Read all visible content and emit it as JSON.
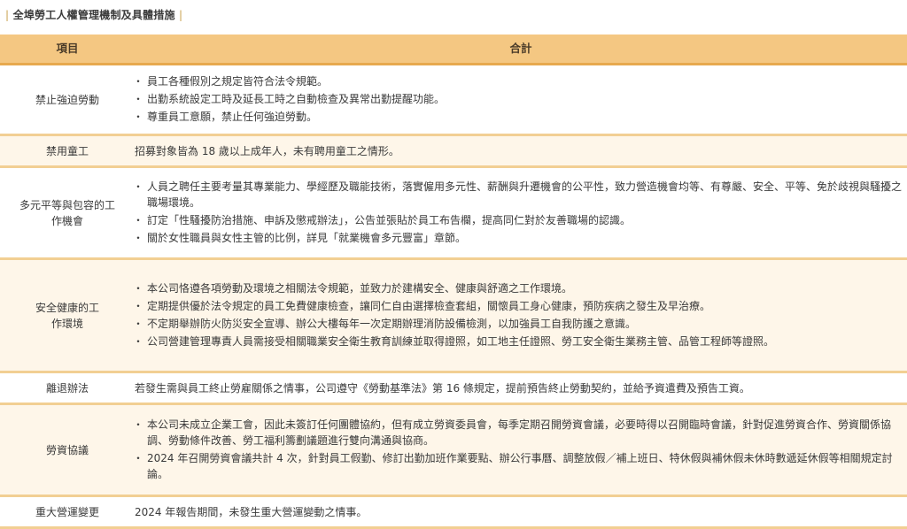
{
  "title": "全埠勞工人權管理機制及具體措施",
  "header": {
    "col1": "項目",
    "col2": "合計"
  },
  "rows": [
    {
      "label": "禁止強迫勞動",
      "items": [
        "員工各種假別之規定皆符合法令規範。",
        "出勤系統設定工時及延長工時之自動檢查及異常出勤提醒功能。",
        "尊重員工意願，禁止任何強迫勞動。"
      ]
    },
    {
      "label": "禁用童工",
      "text": "招募對象皆為 18 歲以上成年人，未有聘用童工之情形。"
    },
    {
      "label": "多元平等與包容的工作機會",
      "items": [
        "人員之聘任主要考量其專業能力、學經歷及職能技術，落實僱用多元性、薪酬與升遷機會的公平性，致力營造機會均等、有尊嚴、安全、平等、免於歧視與騷擾之職場環境。",
        "訂定「性騷擾防治措施、申訴及懲戒辦法」，公告並張貼於員工布告欄，提高同仁對於友善職場的認識。",
        "關於女性職員與女性主管的比例，詳見「就業機會多元豐富」章節。"
      ]
    },
    {
      "label": "安全健康的工作環境",
      "items": [
        "本公司恪遵各項勞動及環境之相關法令規範，並致力於建構安全、健康與舒適之工作環境。",
        "定期提供優於法令規定的員工免費健康檢查，讓同仁自由選擇檢查套組，關懷員工身心健康，預防疾病之發生及早治療。",
        "不定期舉辦防火防災安全宣導、辦公大樓每年一次定期辦理消防設備檢測，以加強員工自我防護之意識。",
        "公司營建管理專責人員需接受相關職業安全衛生教育訓練並取得證照，如工地主任證照、勞工安全衛生業務主管、品管工程師等證照。"
      ]
    },
    {
      "label": "離退辦法",
      "text": "若發生需與員工終止勞雇關係之情事，公司遵守《勞動基準法》第 16 條規定，提前預告終止勞動契約，並給予資遣費及預告工資。"
    },
    {
      "label": "勞資協議",
      "items": [
        "本公司未成立企業工會，因此未簽訂任何團體協約，但有成立勞資委員會，每季定期召開勞資會議，必要時得以召開臨時會議，針對促進勞資合作、勞資關係協調、勞動條件改善、勞工福利籌劃議題進行雙向溝通與協商。",
        "2024 年召開勞資會議共計 4 次，針對員工假勤、修訂出勤加班作業要點、辦公行事曆、調整放假／補上班日、特休假與補休假未休時數遞延休假等相關規定討論。"
      ]
    },
    {
      "label": "重大營運變更",
      "text": "2024 年報告期間，未發生重大營運變動之情事。"
    }
  ]
}
